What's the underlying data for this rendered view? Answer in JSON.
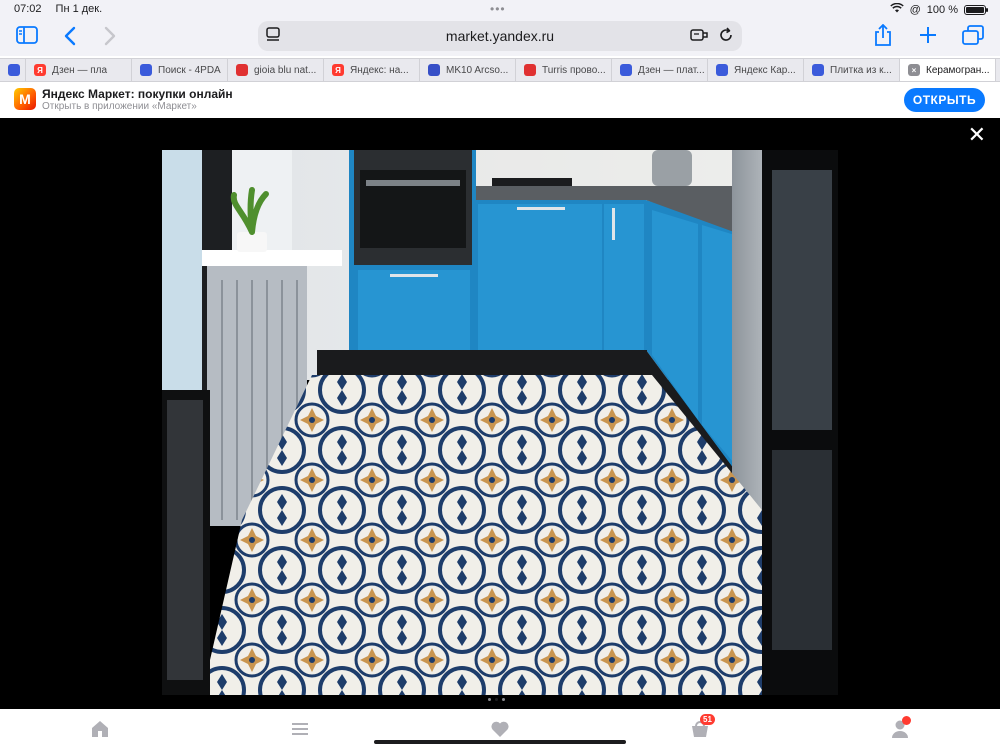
{
  "status": {
    "time": "07:02",
    "date": "Пн 1 дек.",
    "battery": "100 %",
    "battery_level": 1.0
  },
  "toolbar": {
    "url": "market.yandex.ru"
  },
  "tabs": [
    {
      "label": "",
      "fav_color": "#3b5bdb",
      "fav_text": ""
    },
    {
      "label": "Дзен — пла",
      "fav_color": "#ff3b30",
      "fav_text": "Я"
    },
    {
      "label": "Поиск - 4PDA",
      "fav_color": "#3b5bdb",
      "fav_text": ""
    },
    {
      "label": "gioia blu nat...",
      "fav_color": "#e03131",
      "fav_text": ""
    },
    {
      "label": "Яндекс: на...",
      "fav_color": "#ff3b30",
      "fav_text": "Я"
    },
    {
      "label": "MK10 Arcso...",
      "fav_color": "#364fc7",
      "fav_text": ""
    },
    {
      "label": "Turris прово...",
      "fav_color": "#e03131",
      "fav_text": ""
    },
    {
      "label": "Дзен — плат...",
      "fav_color": "#3b5bdb",
      "fav_text": ""
    },
    {
      "label": "Яндекс Кар...",
      "fav_color": "#3b5bdb",
      "fav_text": ""
    },
    {
      "label": "Плитка из к...",
      "fav_color": "#3b5bdb",
      "fav_text": ""
    },
    {
      "label": "Керамогран...",
      "fav_color": "#8e8e93",
      "fav_text": "×",
      "active": true
    }
  ],
  "banner": {
    "logo_text": "M",
    "title": "Яндекс Маркет: покупки онлайн",
    "subtitle": "Открыть в приложении «Маркет»",
    "open_label": "ОТКРЫТЬ"
  },
  "gallery": {
    "close_label": "✕",
    "page_count": 3,
    "current_page": 2
  },
  "bottom_nav": {
    "cart_badge": "51"
  },
  "colors": {
    "accent": "#0a7aff",
    "cabinet_blue": "#1f86c3",
    "tile_navy": "#1e3d6b",
    "tile_ochre": "#c9954f"
  }
}
